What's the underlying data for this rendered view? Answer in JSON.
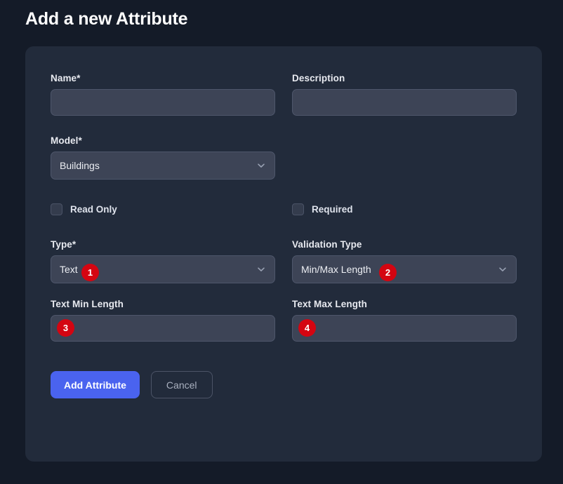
{
  "page": {
    "title": "Add a new Attribute",
    "background_color": "#141b28",
    "card_color": "#222b3b",
    "accent_color": "#4a63ef",
    "badge_color": "#d40511"
  },
  "form": {
    "name": {
      "label": "Name*",
      "value": "",
      "placeholder": ""
    },
    "description": {
      "label": "Description",
      "value": "",
      "placeholder": ""
    },
    "model": {
      "label": "Model*",
      "selected": "Buildings",
      "chevron_icon": "chevron-down-icon"
    },
    "read_only": {
      "label": "Read Only",
      "checked": false
    },
    "required": {
      "label": "Required",
      "checked": false
    },
    "type": {
      "label": "Type*",
      "selected": "Text",
      "chevron_icon": "chevron-down-icon",
      "badge": "1"
    },
    "validation_type": {
      "label": "Validation Type",
      "selected": "Min/Max Length",
      "chevron_icon": "chevron-down-icon",
      "badge": "2"
    },
    "text_min_length": {
      "label": "Text Min Length",
      "value": "",
      "placeholder": "",
      "badge": "3"
    },
    "text_max_length": {
      "label": "Text Max Length",
      "value": "",
      "placeholder": "",
      "badge": "4"
    }
  },
  "actions": {
    "submit_label": "Add Attribute",
    "cancel_label": "Cancel"
  }
}
